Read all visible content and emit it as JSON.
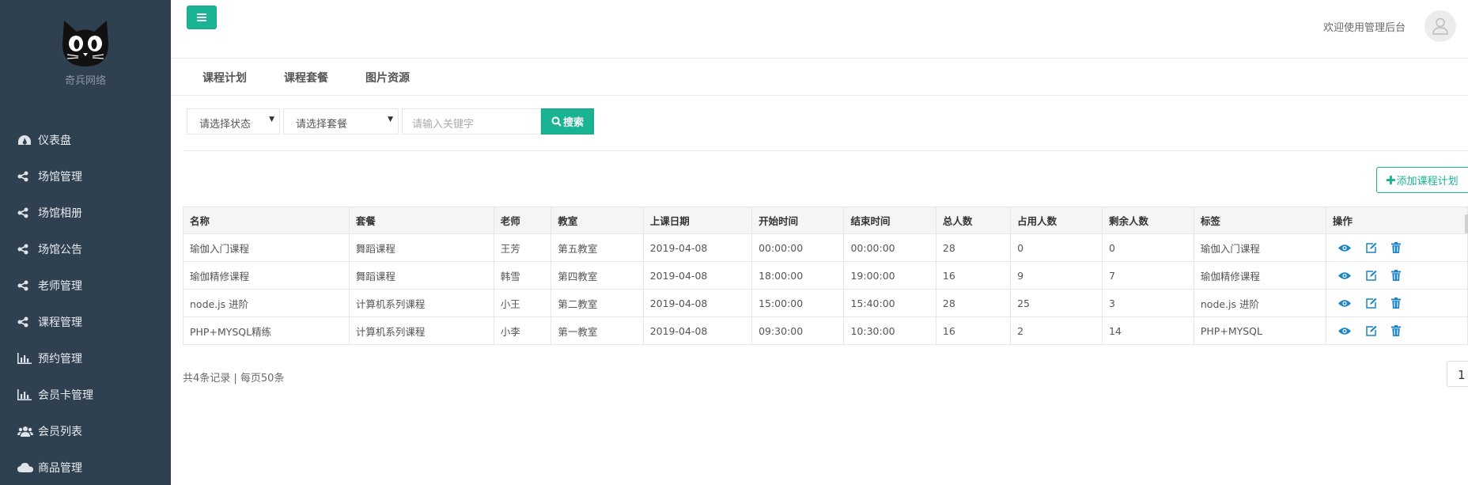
{
  "brand": {
    "name": "奇兵网络"
  },
  "sidebar": {
    "items": [
      {
        "label": "仪表盘",
        "icon": "dashboard-icon"
      },
      {
        "label": "场馆管理",
        "icon": "share-icon"
      },
      {
        "label": "场馆相册",
        "icon": "share-icon"
      },
      {
        "label": "场馆公告",
        "icon": "share-icon"
      },
      {
        "label": "老师管理",
        "icon": "share-icon"
      },
      {
        "label": "课程管理",
        "icon": "share-icon"
      },
      {
        "label": "预约管理",
        "icon": "bar-chart-icon"
      },
      {
        "label": "会员卡管理",
        "icon": "bar-chart-icon"
      },
      {
        "label": "会员列表",
        "icon": "users-icon"
      },
      {
        "label": "商品管理",
        "icon": "cloud-icon"
      }
    ]
  },
  "header": {
    "welcome": "欢迎使用管理后台"
  },
  "tabs": [
    "课程计划",
    "课程套餐",
    "图片资源"
  ],
  "filters": {
    "status_placeholder": "请选择状态",
    "package_placeholder": "请选择套餐",
    "keyword_placeholder": "请输入关键字",
    "search_label": "搜索"
  },
  "add_button": {
    "label": "添加课程计划"
  },
  "table": {
    "columns": [
      "名称",
      "套餐",
      "老师",
      "教室",
      "上课日期",
      "开始时间",
      "结束时间",
      "总人数",
      "占用人数",
      "剩余人数",
      "标签",
      "操作"
    ],
    "rows": [
      [
        "瑜伽入门课程",
        "舞蹈课程",
        "王芳",
        "第五教室",
        "2019-04-08",
        "00:00:00",
        "00:00:00",
        "28",
        "0",
        "0",
        "瑜伽入门课程"
      ],
      [
        "瑜伽精修课程",
        "舞蹈课程",
        "韩雪",
        "第四教室",
        "2019-04-08",
        "18:00:00",
        "19:00:00",
        "16",
        "9",
        "7",
        "瑜伽精修课程"
      ],
      [
        "node.js 进阶",
        "计算机系列课程",
        "小王",
        "第二教室",
        "2019-04-08",
        "15:00:00",
        "15:40:00",
        "28",
        "25",
        "3",
        "node.js 进阶"
      ],
      [
        "PHP+MYSQL精练",
        "计算机系列课程",
        "小李",
        "第一教室",
        "2019-04-08",
        "09:30:00",
        "10:30:00",
        "16",
        "2",
        "14",
        "PHP+MYSQL"
      ]
    ]
  },
  "pagination": {
    "summary": "共4条记录 | 每页50条",
    "current_page": "1"
  },
  "colors": {
    "accent": "#1ab394",
    "sidebar_bg": "#2f4050",
    "action_icon": "#1c84c6"
  }
}
